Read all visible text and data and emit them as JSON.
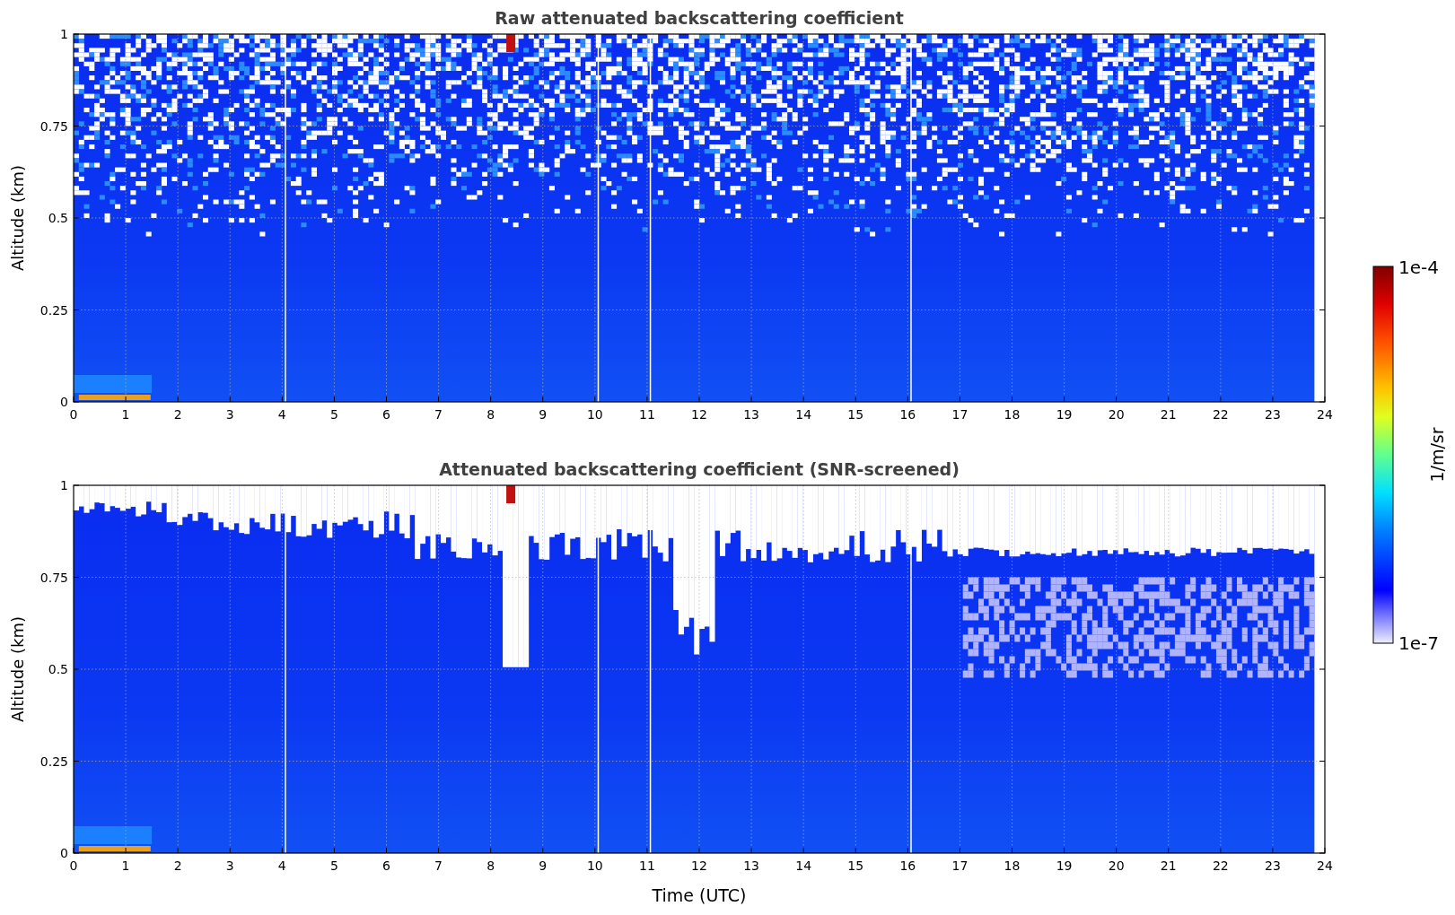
{
  "panels": [
    {
      "title": "Raw attenuated backscattering coefficient",
      "kind": "raw",
      "ylabel": "Altitude (km)",
      "yticks": [
        "1",
        "0.75",
        "0.5",
        "0.25",
        "0"
      ],
      "xticks": [
        "0",
        "1",
        "2",
        "3",
        "4",
        "5",
        "6",
        "7",
        "8",
        "9",
        "10",
        "11",
        "12",
        "13",
        "14",
        "15",
        "16",
        "17",
        "18",
        "19",
        "20",
        "21",
        "22",
        "23",
        "24"
      ]
    },
    {
      "title": "Attenuated backscattering coefficient (SNR-screened)",
      "kind": "screened",
      "ylabel": "Altitude (km)",
      "yticks": [
        "1",
        "0.75",
        "0.5",
        "0.25",
        "0"
      ],
      "xticks": [
        "0",
        "1",
        "2",
        "3",
        "4",
        "5",
        "6",
        "7",
        "8",
        "9",
        "10",
        "11",
        "12",
        "13",
        "14",
        "15",
        "16",
        "17",
        "18",
        "19",
        "20",
        "21",
        "22",
        "23",
        "24"
      ]
    }
  ],
  "xlabel": "Time (UTC)",
  "colorbar": {
    "max_label": "1e-4",
    "min_label": "1e-7",
    "unit": "1/m/sr"
  }
}
